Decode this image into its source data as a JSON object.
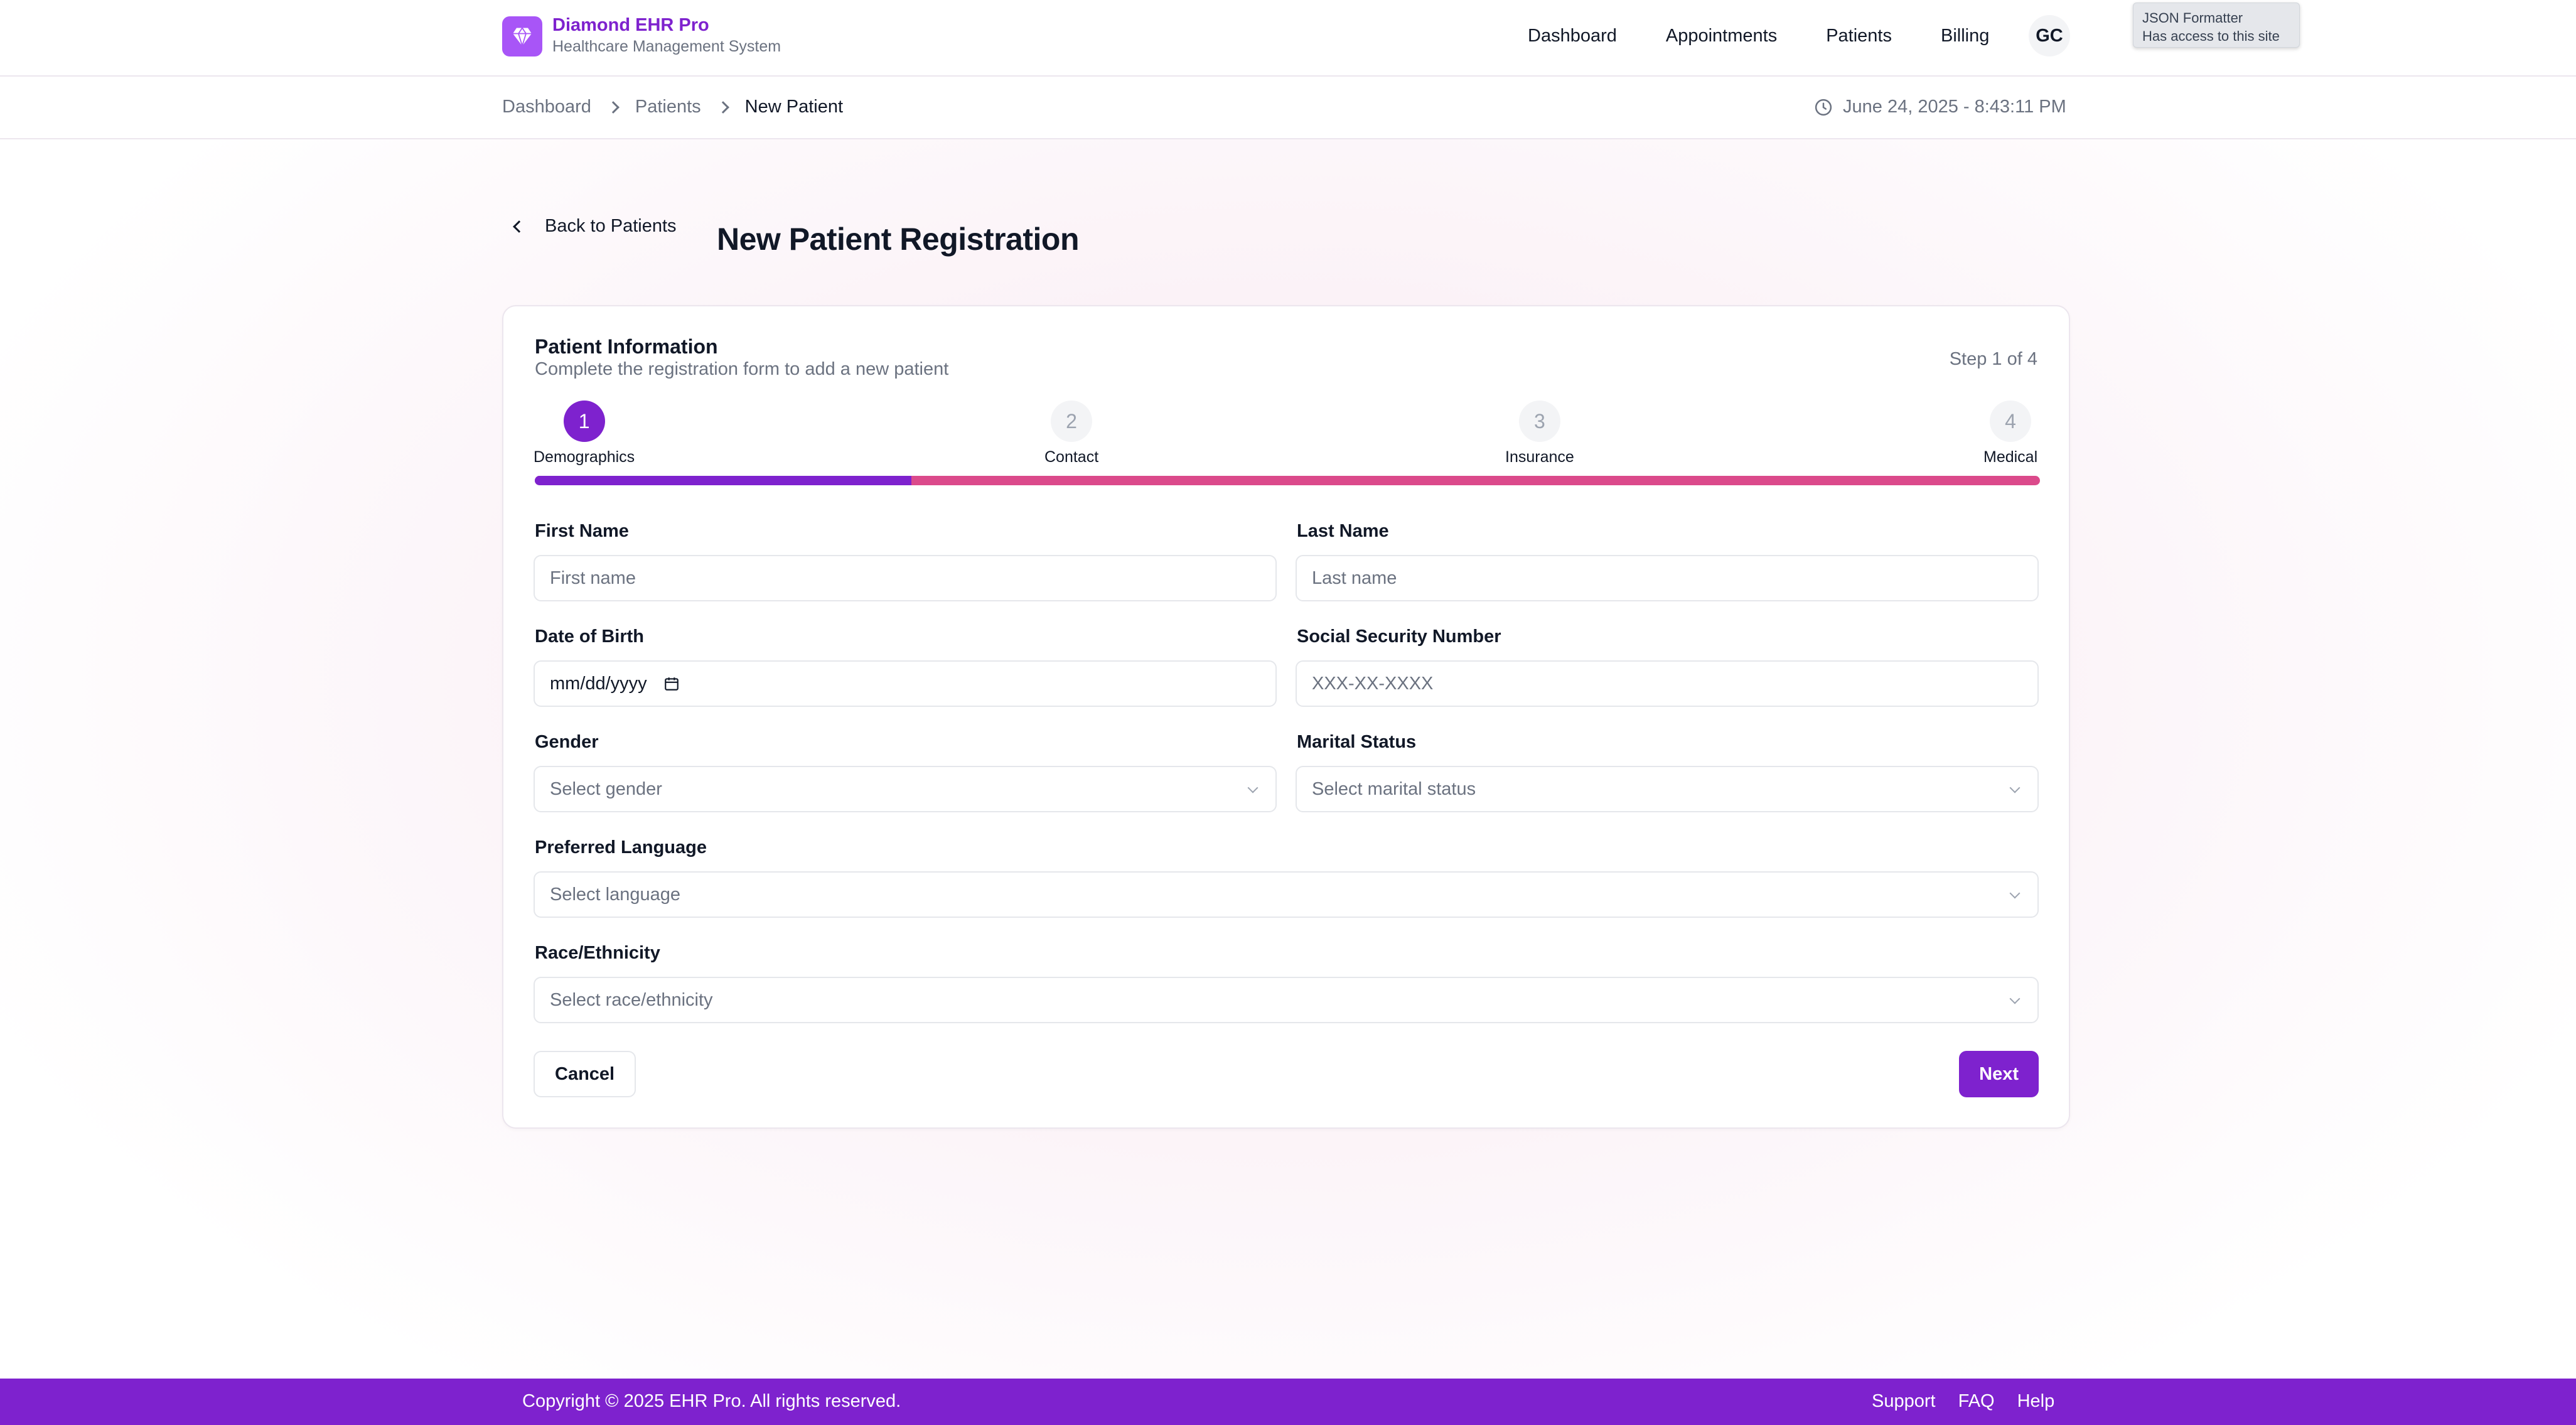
{
  "brand": {
    "name": "Diamond EHR Pro",
    "subtitle": "Healthcare Management System",
    "logo_icon": "diamond-icon"
  },
  "nav": {
    "items": [
      {
        "label": "Dashboard"
      },
      {
        "label": "Appointments"
      },
      {
        "label": "Patients"
      },
      {
        "label": "Billing"
      }
    ],
    "avatar_initials": "GC"
  },
  "extension_tooltip": {
    "title": "JSON Formatter",
    "body": "Has access to this site"
  },
  "breadcrumb": {
    "items": [
      "Dashboard",
      "Patients",
      "New Patient"
    ],
    "datetime": "June 24, 2025 - 8:43:11 PM"
  },
  "page": {
    "back_label": "Back to Patients",
    "title": "New Patient Registration"
  },
  "card": {
    "title": "Patient Information",
    "description": "Complete the registration form to add a new patient",
    "step_count": "Step 1 of 4",
    "progress_fraction": 0.25
  },
  "steps": [
    {
      "number": "1",
      "label": "Demographics",
      "active": true
    },
    {
      "number": "2",
      "label": "Contact",
      "active": false
    },
    {
      "number": "3",
      "label": "Insurance",
      "active": false
    },
    {
      "number": "4",
      "label": "Medical",
      "active": false
    }
  ],
  "form": {
    "first_name": {
      "label": "First Name",
      "placeholder": "First name"
    },
    "last_name": {
      "label": "Last Name",
      "placeholder": "Last name"
    },
    "dob": {
      "label": "Date of Birth",
      "placeholder": "mm/dd/yyyy"
    },
    "ssn": {
      "label": "Social Security Number",
      "placeholder": "XXX-XX-XXXX"
    },
    "gender": {
      "label": "Gender",
      "placeholder": "Select gender"
    },
    "marital_status": {
      "label": "Marital Status",
      "placeholder": "Select marital status"
    },
    "language": {
      "label": "Preferred Language",
      "placeholder": "Select language"
    },
    "race": {
      "label": "Race/Ethnicity",
      "placeholder": "Select race/ethnicity"
    }
  },
  "actions": {
    "cancel_label": "Cancel",
    "next_label": "Next"
  },
  "footer": {
    "copyright": "Copyright © 2025 EHR Pro. All rights reserved.",
    "links": [
      "Support",
      "FAQ",
      "Help"
    ]
  },
  "colors": {
    "accent": "#7e22ce",
    "logo": "#a855f7",
    "progress_track": "#db4a8b"
  }
}
